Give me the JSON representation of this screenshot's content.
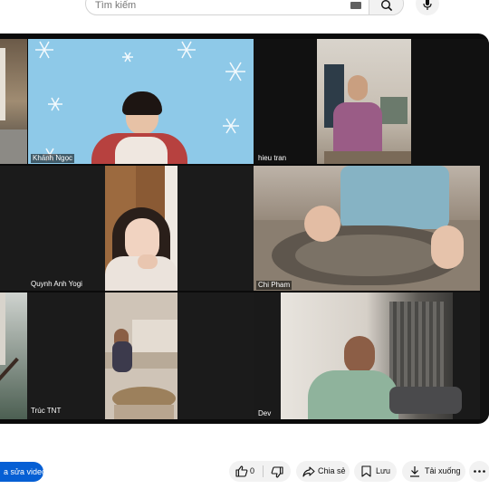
{
  "search": {
    "placeholder": "Tìm kiếm"
  },
  "participants": [
    {
      "name": "Khánh Ngọc"
    },
    {
      "name": "hieu tran"
    },
    {
      "name": "Quynh Anh Yogi"
    },
    {
      "name": "Chi Pham"
    },
    {
      "name": "Trúc TNT"
    },
    {
      "name": "Dev"
    }
  ],
  "actions": {
    "edit_video": "a sửa video",
    "like_count": "0",
    "share": "Chia sẻ",
    "save": "Lưu",
    "download": "Tải xuống"
  },
  "colors": {
    "accent": "#065fd4",
    "snow_bg": "#8ec9e8"
  },
  "icons": [
    "search-icon",
    "keyboard-icon",
    "mic-icon",
    "thumbs-up-icon",
    "thumbs-down-icon",
    "share-icon",
    "bookmark-icon",
    "download-icon",
    "more-icon"
  ]
}
